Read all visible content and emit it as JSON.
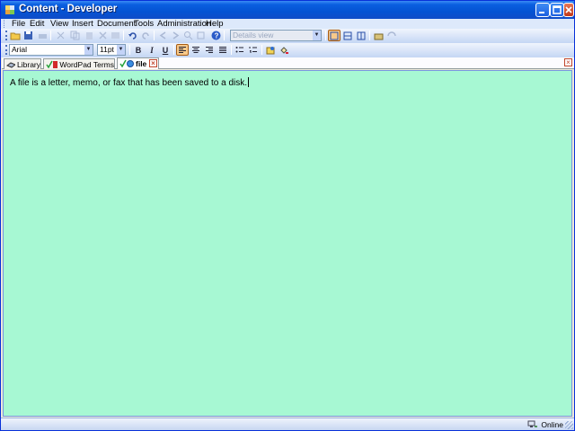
{
  "window": {
    "title": "Content - Developer",
    "app_icon": "content-app-icon"
  },
  "menu": {
    "items": [
      {
        "label": "File"
      },
      {
        "label": "Edit"
      },
      {
        "label": "View"
      },
      {
        "label": "Insert"
      },
      {
        "label": "Document"
      },
      {
        "label": "Tools"
      },
      {
        "label": "Administration"
      },
      {
        "label": "Help"
      }
    ]
  },
  "toolbar_standard": {
    "view_combo": {
      "value": "Details view",
      "disabled": true
    },
    "buttons": [
      {
        "icon": "open-folder-icon",
        "enabled": true
      },
      {
        "icon": "save-icon",
        "enabled": true
      },
      {
        "icon": "undo-icon",
        "enabled": true
      },
      {
        "icon": "redo-icon",
        "enabled": false
      },
      {
        "icon": "help-icon",
        "enabled": true
      }
    ]
  },
  "toolbar_format": {
    "font_combo": {
      "value": "Arial"
    },
    "size_combo": {
      "value": "11pt"
    },
    "bold": "B",
    "italic": "I",
    "underline": "U"
  },
  "tabs": [
    {
      "label": "Library",
      "icon": "library-icon"
    },
    {
      "label": "WordPad Terms",
      "icon": "wordpad-terms-icon"
    },
    {
      "label": "file",
      "icon": "file-tab-icon",
      "active": true
    }
  ],
  "editor": {
    "text": "A file is a letter, memo, or fax that has been saved to a disk.",
    "background": "#a7f8d3"
  },
  "status": {
    "online": "Online"
  },
  "colors": {
    "titlebar": "#0453d3",
    "editor_bg": "#a7f8d3",
    "toolbar": "#c4d6f4",
    "active_button": "#f7c98a"
  }
}
